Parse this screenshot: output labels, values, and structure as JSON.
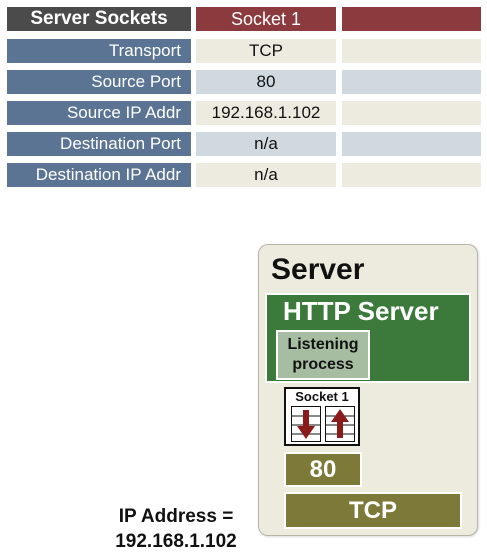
{
  "table": {
    "header": {
      "label": "Server Sockets",
      "socket": "Socket 1"
    },
    "rows": [
      {
        "label": "Transport",
        "value": "TCP"
      },
      {
        "label": "Source Port",
        "value": "80"
      },
      {
        "label": "Source IP Addr",
        "value": "192.168.1.102"
      },
      {
        "label": "Destination Port",
        "value": "n/a"
      },
      {
        "label": "Destination IP Addr",
        "value": "n/a"
      }
    ]
  },
  "diagram": {
    "server_title": "Server",
    "app_title": "HTTP Server",
    "process_line1": "Listening",
    "process_line2": "process",
    "socket_label": "Socket 1",
    "port": "80",
    "transport": "TCP",
    "ip_line1": "IP Address =",
    "ip_line2": "192.168.1.102"
  },
  "colors": {
    "header_label": "#4b4b4b",
    "header_socket": "#8b3a3e",
    "row_label": "#5b7494",
    "app_box": "#3c7a3c",
    "process_box": "#a7bda2",
    "transport_box": "#7d7a39",
    "arrow": "#8b1a1a"
  }
}
